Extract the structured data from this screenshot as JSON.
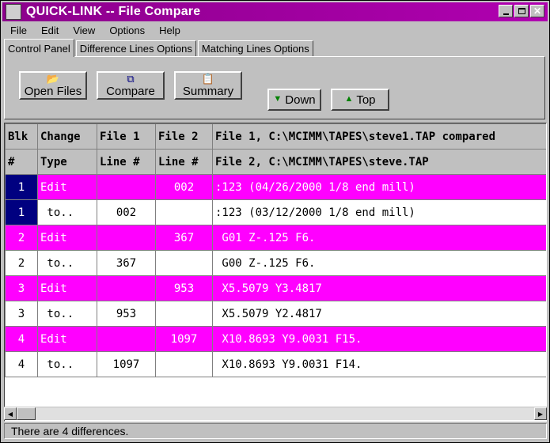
{
  "window": {
    "title": "QUICK-LINK --  File Compare",
    "icon": "app-icon"
  },
  "menu": [
    "File",
    "Edit",
    "View",
    "Options",
    "Help"
  ],
  "tabs": [
    "Control Panel",
    "Difference Lines Options",
    "Matching Lines Options"
  ],
  "toolbar": {
    "open_files": "Open Files",
    "compare": "Compare",
    "summary": "Summary",
    "down": "Down",
    "top": "Top"
  },
  "grid": {
    "header1": [
      "Blk",
      "Change",
      "File 1",
      "File 2",
      "File 1, C:\\MCIMM\\TAPES\\steve1.TAP compared"
    ],
    "header2": [
      "#",
      "Type",
      "Line #",
      "Line #",
      "File 2, C:\\MCIMM\\TAPES\\steve.TAP"
    ],
    "rows": [
      {
        "blk": "1",
        "type": "Edit",
        "line1": "",
        "line2": "002",
        "text": ":123 (04/26/2000 1/8 end mill)",
        "style": "pink"
      },
      {
        "blk": "1",
        "type": " to..",
        "line1": "002",
        "line2": "",
        "text": ":123 (03/12/2000 1/8 end mill)",
        "style": "white"
      },
      {
        "blk": "2",
        "type": "Edit",
        "line1": "",
        "line2": "367",
        "text": " G01 Z-.125 F6.",
        "style": "pink"
      },
      {
        "blk": "2",
        "type": " to..",
        "line1": "367",
        "line2": "",
        "text": " G00 Z-.125 F6.",
        "style": "white"
      },
      {
        "blk": "3",
        "type": "Edit",
        "line1": "",
        "line2": "953",
        "text": " X5.5079 Y3.4817",
        "style": "pink"
      },
      {
        "blk": "3",
        "type": " to..",
        "line1": "953",
        "line2": "",
        "text": " X5.5079 Y2.4817",
        "style": "white"
      },
      {
        "blk": "4",
        "type": "Edit",
        "line1": "",
        "line2": "1097",
        "text": " X10.8693 Y9.0031 F15.",
        "style": "pink"
      },
      {
        "blk": "4",
        "type": " to..",
        "line1": "1097",
        "line2": "",
        "text": " X10.8693 Y9.0031 F14.",
        "style": "white"
      }
    ]
  },
  "status": "There are 4 differences.",
  "colors": {
    "titlebar": "#8c008c",
    "edit_row": "#ff00ff",
    "selected": "#000080"
  }
}
